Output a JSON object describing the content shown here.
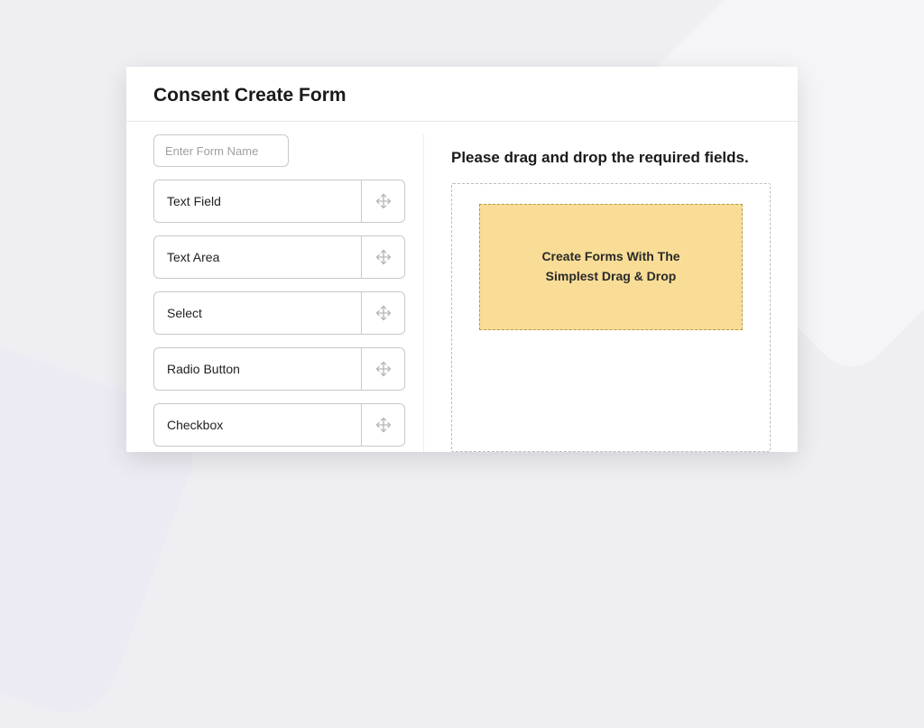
{
  "header": {
    "title": "Consent Create Form"
  },
  "form_name": {
    "placeholder": "Enter Form Name",
    "value": ""
  },
  "fields": [
    {
      "label": "Text Field"
    },
    {
      "label": "Text Area"
    },
    {
      "label": "Select"
    },
    {
      "label": "Radio Button"
    },
    {
      "label": "Checkbox"
    }
  ],
  "dropzone": {
    "instruction": "Please drag and drop the required fields.",
    "inner_text": "Create Forms With The\nSimplest Drag & Drop"
  }
}
